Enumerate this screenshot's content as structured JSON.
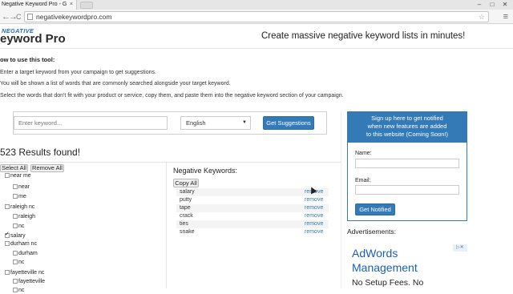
{
  "browser": {
    "tab_title": "Negative Keyword Pro - G",
    "tab_close": "×",
    "url": "negativekeywordpro.com",
    "back": "←",
    "forward": "→",
    "reload": "C",
    "star": "☆",
    "menu": "≡",
    "win_min": "‒",
    "win_max": "□",
    "win_close": "✕"
  },
  "header": {
    "logo_top": "NEGATIVE",
    "logo_main": "eyword Pro",
    "tagline": "Create massive negative keyword lists in minutes!"
  },
  "instructions": {
    "title": "ow to use this tool:",
    "steps": [
      "Enter a target keyword from your campaign to get suggestions.",
      "You will be shown a list of words that are commonly searched alongside your target keyword.",
      "Select the words that don't fit with your product or service, copy them, and paste them into the negative keyword section of your campaign."
    ]
  },
  "search": {
    "keyword_placeholder": "Enter keyword...",
    "language": "English",
    "caret": "▼",
    "submit_label": "Get Suggestions"
  },
  "results": {
    "count_text": "523 Results found!",
    "select_all": "Select All",
    "remove_all": "Remove All",
    "tree": [
      {
        "label": "near me",
        "level": 0,
        "checked": false
      },
      {
        "label": "near",
        "level": 1,
        "checked": false
      },
      {
        "label": "me",
        "level": 1,
        "checked": false
      },
      {
        "label": "raleigh nc",
        "level": 0,
        "checked": false
      },
      {
        "label": "raleigh",
        "level": 1,
        "checked": false
      },
      {
        "label": "nc",
        "level": 1,
        "checked": false
      },
      {
        "label": "salary",
        "level": 0,
        "checked": true
      },
      {
        "label": "durham nc",
        "level": 0,
        "checked": false
      },
      {
        "label": "durham",
        "level": 1,
        "checked": false
      },
      {
        "label": "nc",
        "level": 1,
        "checked": false
      },
      {
        "label": "fayetteville nc",
        "level": 0,
        "checked": false
      },
      {
        "label": "fayetteville",
        "level": 1,
        "checked": false
      },
      {
        "label": "nc",
        "level": 1,
        "checked": false
      }
    ]
  },
  "negatives": {
    "title": "Negative Keywords:",
    "copy_all": "Copy All",
    "remove_label": "remove",
    "items": [
      "salary",
      "putty",
      "tape",
      "crack",
      "ties",
      "snake"
    ]
  },
  "signup": {
    "head_lines": [
      "Sign up here to get notified",
      "when new features are added",
      "to this website (Coming Soon!)"
    ],
    "name_label": "Name:",
    "email_label": "Email:",
    "button": "Get Notified"
  },
  "ads": {
    "title": "Advertisements:",
    "line1": "AdWords",
    "line2": "Management",
    "line3": "No Setup Fees. No",
    "badge": "▷✕"
  }
}
